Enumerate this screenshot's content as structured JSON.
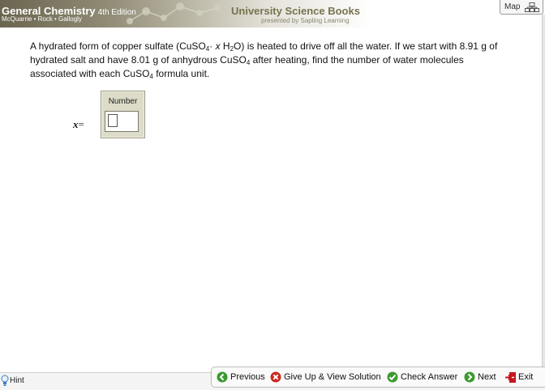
{
  "header": {
    "book_title": "General Chemistry",
    "edition": "4th Edition",
    "authors": "McQuarrie • Rock • Gallogly",
    "publisher": "University Science Books",
    "presented_by": "presented by Sapling Learning",
    "map_label": "Map"
  },
  "question": {
    "p1": "A hydrated form of copper sulfate (CuSO",
    "s1": "4",
    "p2": "· ",
    "p3": "x",
    "p4": " H",
    "s2": "2",
    "p5": "O) is heated to drive off all the water. If we start with 8.91 g of hydrated salt and have 8.01 g of anhydrous CuSO",
    "s3": "4",
    "p6": " after heating, find the number of water molecules associated with each CuSO",
    "s4": "4",
    "p7": " formula unit."
  },
  "answer": {
    "variable": "x",
    "equals": "=",
    "caption": "Number",
    "value": ""
  },
  "footer": {
    "hint": "Hint",
    "previous": "Previous",
    "give_up": "Give Up & View Solution",
    "check": "Check Answer",
    "next": "Next",
    "exit": "Exit"
  },
  "colors": {
    "nav_green": "#3b9a2f",
    "give_up_red": "#cc2a1e",
    "exit_red": "#c8161d",
    "publisher": "#77734f"
  }
}
